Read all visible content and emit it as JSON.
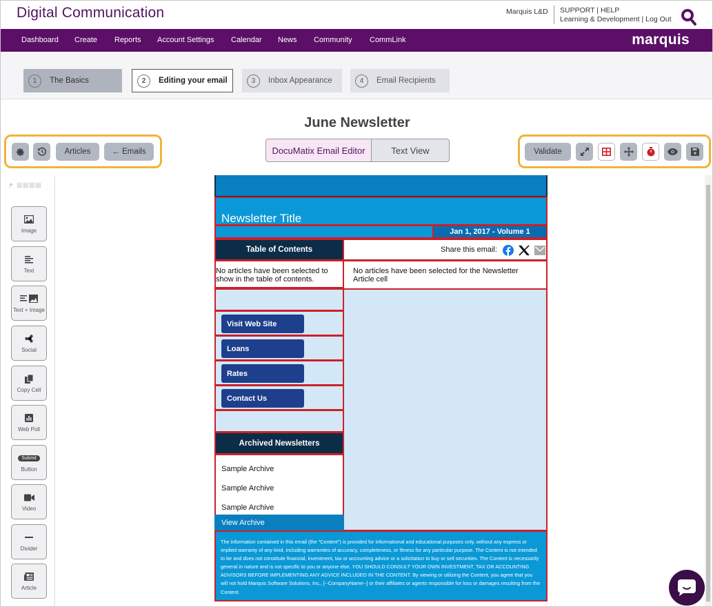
{
  "header": {
    "app_title": "Digital Communication",
    "user": "Marquis L&D",
    "support_line": "SUPPORT | HELP",
    "account_line": "Learning & Development | Log Out"
  },
  "nav": {
    "items": [
      "Dashboard",
      "Create",
      "Reports",
      "Account Settings",
      "Calendar",
      "News",
      "Community",
      "CommLink"
    ],
    "logo": "marquis"
  },
  "steps": [
    {
      "num": "1",
      "label": "The Basics",
      "state": "done"
    },
    {
      "num": "2",
      "label": "Editing your email",
      "state": "active"
    },
    {
      "num": "3",
      "label": "Inbox Appearance",
      "state": "todo"
    },
    {
      "num": "4",
      "label": "Email Recipients",
      "state": "todo"
    }
  ],
  "document": {
    "title": "June Newsletter"
  },
  "left_toolbar": {
    "articles": "Articles",
    "emails": "← Emails"
  },
  "mode_tabs": {
    "editor": "DocuMatix Email Editor",
    "text": "Text View"
  },
  "right_toolbar": {
    "validate": "Validate"
  },
  "palette": {
    "top_glyphs": "↱ ☒☒☒☒",
    "items": [
      "Image",
      "Text",
      "Text + Image",
      "Social",
      "Copy Cell",
      "Web Poll",
      "Button",
      "Video",
      "Divider",
      "Article"
    ],
    "submit_badge": "Submit"
  },
  "email": {
    "newsletter_title": "Newsletter Title",
    "date_volume": "Jan 1, 2017 - Volume 1",
    "toc_heading": "Table of Contents",
    "share_label": "Share this email:",
    "toc_empty": "No articles have been selected to show in the table of contents.",
    "article_empty": "No articles have been selected for the Newsletter Article cell",
    "buttons": [
      "Visit Web Site",
      "Loans",
      "Rates",
      "Contact Us"
    ],
    "archive_heading": "Archived Newsletters",
    "archives": [
      "Sample Archive",
      "Sample Archive",
      "Sample Archive"
    ],
    "view_archive": "View Archive",
    "disclaimer": "The information contained in this email (the \"Content\") is provided for informational and educational purposes only, without any express or implied warranty of any kind, including warranties of accuracy, completeness, or fitness for any particular purpose. The Content is not intended to be and does not constitute financial, investment, tax or accounting advice or a solicitation to buy or sell securities. The Content is necessarily general in nature and is not specific to you or anyone else.  YOU SHOULD CONSULT YOUR OWN INVESTMENT, TAX OR ACCOUNTING ADVISORS BEFORE IMPLEMENTING ANY ADVICE INCLUDED IN THE CONTENT. By viewing or utilizing the Content, you agree that you will not hold Marquis Software Solutions, Inc., [--CompanyName--] or their affiliates or agents responsible for loss or damages resulting from the Content."
  },
  "colors": {
    "brand_purple": "#5c0f67",
    "highlight": "#f0b43a",
    "email_blue": "#0a98d6",
    "cell_border": "#cc2027",
    "button_navy": "#1e3f8c"
  }
}
